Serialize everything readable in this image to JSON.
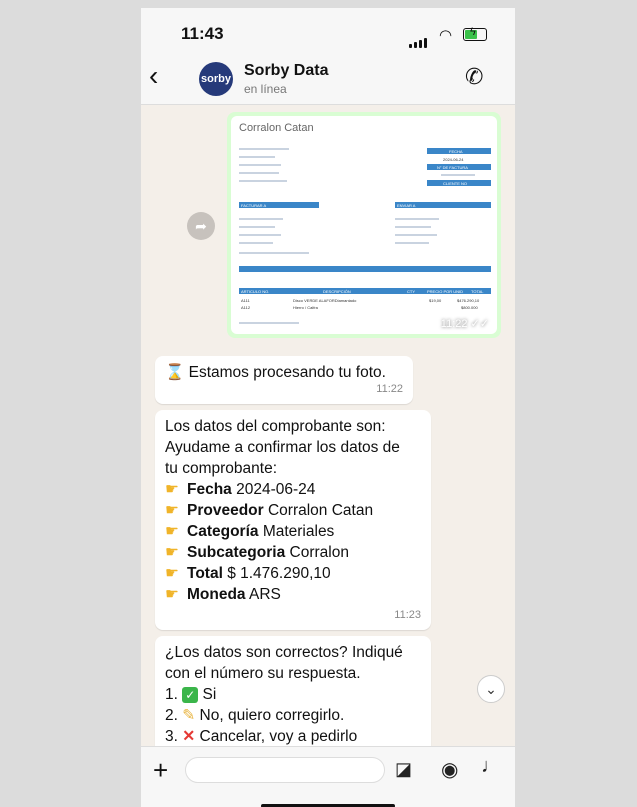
{
  "status_bar": {
    "time": "11:43"
  },
  "header": {
    "back": "‹",
    "avatar_text": "sorby",
    "contact_name": "Sorby Data",
    "contact_status": "en línea"
  },
  "image_message": {
    "receipt_title": "Corralon Catan",
    "labels": {
      "fecha": "FECHA",
      "factura": "N° DE FACTURA",
      "cliente": "CLIENTE NO",
      "facturar": "FACTURAR A",
      "enviar": "ENVIAR A",
      "articulo": "ARTICULO NO.",
      "descripcion": "DESCRIPCIÓN",
      "cty": "CTY",
      "precio": "PRECIO POR UNID",
      "total": "TOTAL"
    },
    "date_value": "2024-06-24",
    "row1": {
      "code": "A111",
      "desc": "Disco VERDE ALAFORDiamantado",
      "price": "$19,00",
      "total": "$476.290,10"
    },
    "row2": {
      "code": "A112",
      "desc": "Hierro / Calfra",
      "total": "$800.000"
    },
    "time": "11:22"
  },
  "messages": [
    {
      "text": "Estamos procesando tu foto.",
      "time": "11:22"
    },
    {
      "intro": [
        "Los datos del comprobante son:",
        "Ayudame a confirmar los datos de",
        "tu comprobante:"
      ],
      "fields": [
        {
          "label": "Fecha",
          "value": "2024-06-24"
        },
        {
          "label": "Proveedor",
          "value": "Corralon Catan"
        },
        {
          "label": "Categoría",
          "value": "Materiales"
        },
        {
          "label": "Subcategoria",
          "value": "Corralon"
        },
        {
          "label": "Total",
          "value": "$ 1.476.290,10"
        },
        {
          "label": "Moneda",
          "value": "ARS"
        }
      ],
      "time": "11:23"
    },
    {
      "intro": [
        "¿Los datos son correctos? Indiqué",
        "con el número su respuesta."
      ],
      "options": [
        "Si",
        "No, quiero corregirlo.",
        "Cancelar, voy a pedirlo"
      ]
    }
  ],
  "icons": {
    "hourglass": "hourglass-icon",
    "hand": "pointing-hand-icon",
    "check": "check-icon",
    "pencil": "pencil-icon",
    "cross": "cross-icon"
  }
}
